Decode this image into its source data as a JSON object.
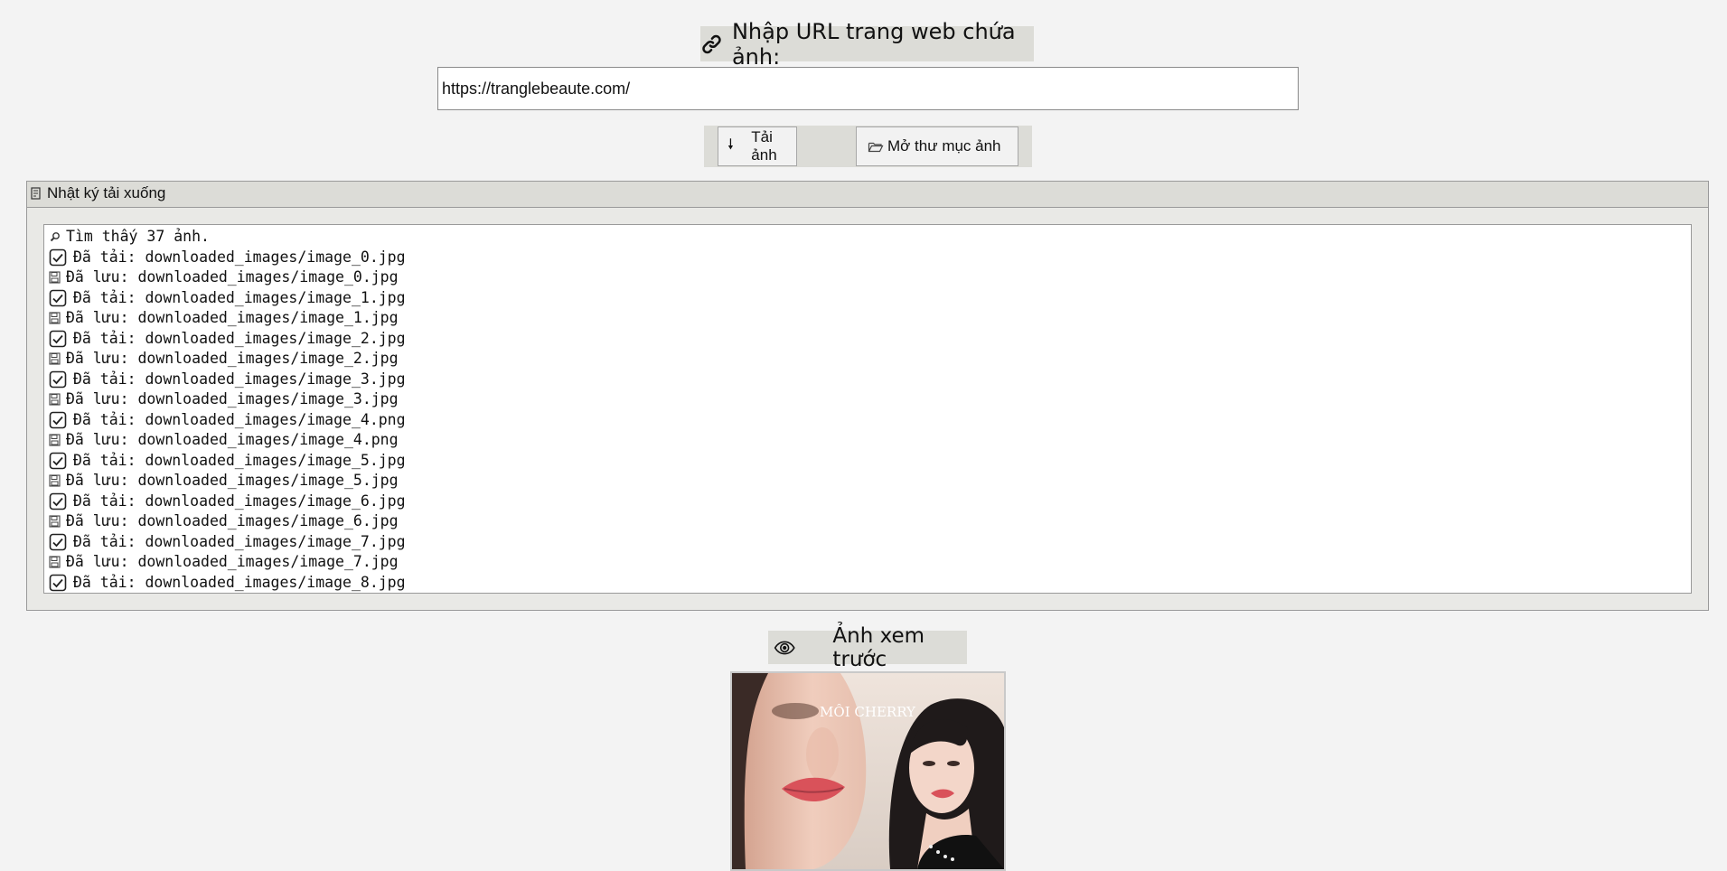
{
  "url_section": {
    "label": "Nhập URL trang web chứa ảnh:",
    "label_icon": "link-icon",
    "url_value": "https://tranglebeaute.com/"
  },
  "buttons": {
    "download_label": "Tải ảnh",
    "download_icon": "down-arrow-icon",
    "open_folder_label": "Mở thư mục ảnh",
    "open_folder_icon": "folder-open-icon"
  },
  "log_section": {
    "title": "Nhật ký tải xuống",
    "title_icon": "scroll-icon",
    "lines": [
      {
        "type": "found",
        "icon": "magnifier-icon",
        "text": "Tìm thấy 37 ảnh."
      },
      {
        "type": "downloaded",
        "icon": "check-box-icon",
        "text": "Đã tải: downloaded_images/image_0.jpg"
      },
      {
        "type": "saved",
        "icon": "floppy-disk-icon",
        "text": "Đã lưu: downloaded_images/image_0.jpg"
      },
      {
        "type": "downloaded",
        "icon": "check-box-icon",
        "text": "Đã tải: downloaded_images/image_1.jpg"
      },
      {
        "type": "saved",
        "icon": "floppy-disk-icon",
        "text": "Đã lưu: downloaded_images/image_1.jpg"
      },
      {
        "type": "downloaded",
        "icon": "check-box-icon",
        "text": "Đã tải: downloaded_images/image_2.jpg"
      },
      {
        "type": "saved",
        "icon": "floppy-disk-icon",
        "text": "Đã lưu: downloaded_images/image_2.jpg"
      },
      {
        "type": "downloaded",
        "icon": "check-box-icon",
        "text": "Đã tải: downloaded_images/image_3.jpg"
      },
      {
        "type": "saved",
        "icon": "floppy-disk-icon",
        "text": "Đã lưu: downloaded_images/image_3.jpg"
      },
      {
        "type": "downloaded",
        "icon": "check-box-icon",
        "text": "Đã tải: downloaded_images/image_4.png"
      },
      {
        "type": "saved",
        "icon": "floppy-disk-icon",
        "text": "Đã lưu: downloaded_images/image_4.png"
      },
      {
        "type": "downloaded",
        "icon": "check-box-icon",
        "text": "Đã tải: downloaded_images/image_5.jpg"
      },
      {
        "type": "saved",
        "icon": "floppy-disk-icon",
        "text": "Đã lưu: downloaded_images/image_5.jpg"
      },
      {
        "type": "downloaded",
        "icon": "check-box-icon",
        "text": "Đã tải: downloaded_images/image_6.jpg"
      },
      {
        "type": "saved",
        "icon": "floppy-disk-icon",
        "text": "Đã lưu: downloaded_images/image_6.jpg"
      },
      {
        "type": "downloaded",
        "icon": "check-box-icon",
        "text": "Đã tải: downloaded_images/image_7.jpg"
      },
      {
        "type": "saved",
        "icon": "floppy-disk-icon",
        "text": "Đã lưu: downloaded_images/image_7.jpg"
      },
      {
        "type": "downloaded",
        "icon": "check-box-icon",
        "text": "Đã tải: downloaded_images/image_8.jpg"
      }
    ]
  },
  "preview_section": {
    "label": "Ảnh xem trước",
    "label_icon": "eye-icon",
    "image_caption": "MÔI CHERRY"
  }
}
